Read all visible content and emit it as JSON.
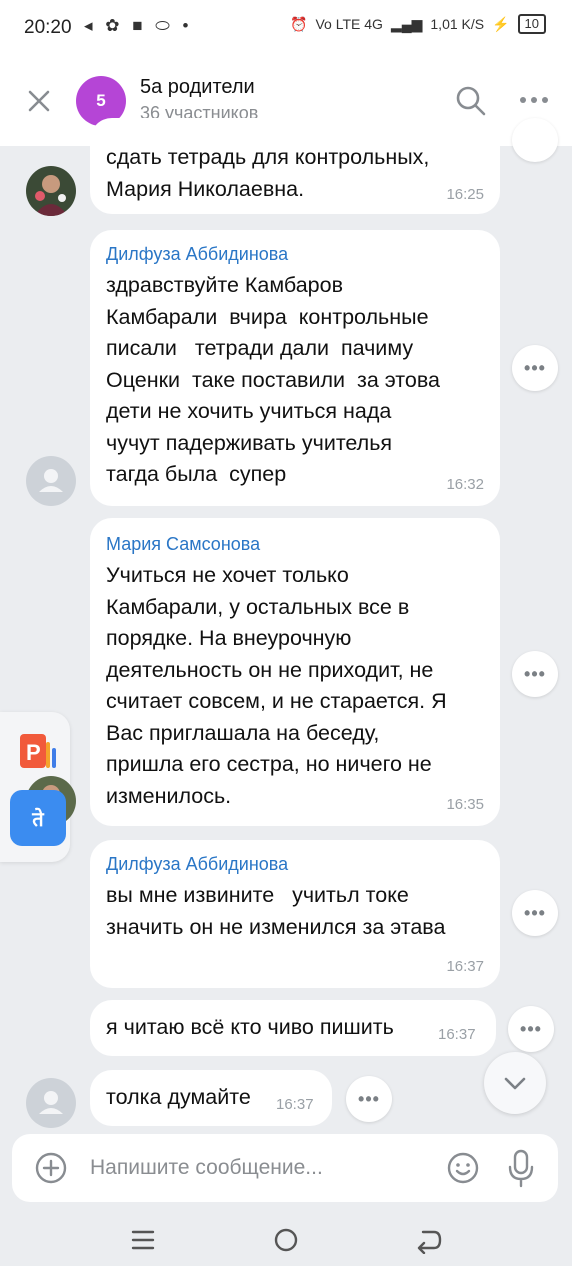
{
  "status_bar": {
    "time": "20:20",
    "left_icons": "◂ ✿ ■ ⬭ •",
    "network": "Vo LTE 4G",
    "speed": "1,01 K/S",
    "battery": "10"
  },
  "header": {
    "avatar_letter": "5",
    "title": "5а родители",
    "subtitle": "36 участников"
  },
  "messages": [
    {
      "text": "сдать тетрадь для контрольных,\nМария Николаевна.",
      "time": "16:25"
    },
    {
      "sender": "Дилфуза Аббидинова",
      "text": "здравствуйте Камбаров\nКамбарали  вчира  контрольные\nписали   тетради дали  пачиму\nОценки  таке поставили  за этова\nдети не хочить учиться нада\nчучут падерживать учителья\nтагда была  супер",
      "time": "16:32"
    },
    {
      "sender": "Мария Самсонова",
      "text": "Учиться не хочет только\nКамбарали, у остальных все в\nпорядке. На внеурочную\nдеятельность он не приходит, не\nсчитает совсем, и не старается. Я\nВас приглашала на беседу,\nпришла его сестра, но ничего не\nизменилось.",
      "time": "16:35"
    },
    {
      "sender": "Дилфуза Аббидинова",
      "text": "вы мне извините   учитьл токе\nзначить он не изменился за этава",
      "time": "16:37"
    },
    {
      "text": "я читаю всё кто чиво пишить",
      "time": "16:37"
    },
    {
      "text": "толка думайте",
      "time": "16:37"
    }
  ],
  "more_label": "•••",
  "translate_glyph": "ते",
  "composer": {
    "placeholder": "Напишите сообщение..."
  },
  "colors": {
    "background": "#ebedf0",
    "sender_name": "#2a76c6",
    "group_avatar": "#b545d6"
  }
}
